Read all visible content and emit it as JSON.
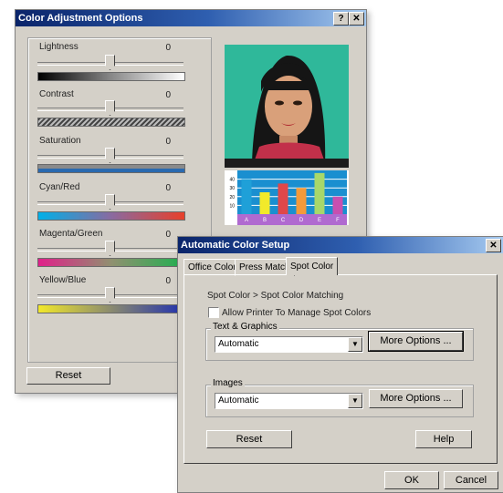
{
  "color_window": {
    "title": "Color Adjustment Options",
    "help_btn": "?",
    "close_btn": "✕",
    "sliders": [
      {
        "label": "Lightness",
        "value": "0"
      },
      {
        "label": "Contrast",
        "value": "0"
      },
      {
        "label": "Saturation",
        "value": "0"
      },
      {
        "label": "Cyan/Red",
        "value": "0"
      },
      {
        "label": "Magenta/Green",
        "value": "0"
      },
      {
        "label": "Yellow/Blue",
        "value": "0"
      }
    ],
    "reset_label": "Reset"
  },
  "preview_chart": {
    "chart_data": {
      "type": "bar",
      "categories": [
        "A",
        "B",
        "C",
        "D",
        "E",
        "F"
      ],
      "series": [
        {
          "values": [
            40,
            25,
            35,
            30,
            47,
            20
          ]
        },
        {
          "values": [
            30,
            null,
            30,
            null,
            40,
            null
          ]
        }
      ],
      "ticks": [
        "10",
        "20",
        "30",
        "40"
      ],
      "ylim": [
        0,
        50
      ],
      "grid": true,
      "colors": [
        "#1fa0d8",
        "#f2ea2a",
        "#e0474a",
        "#f59a3a",
        "#a8d86a",
        "#c84fb0"
      ]
    }
  },
  "spot_window": {
    "title": "Automatic Color Setup",
    "close_btn": "✕",
    "tabs": [
      "Office Color",
      "Press Match",
      "Spot Color"
    ],
    "breadcrumb": "Spot Color > Spot Color Matching",
    "checkbox_label": "Allow Printer To Manage Spot Colors",
    "text_graphics": {
      "label": "Text & Graphics",
      "value": "Automatic",
      "more": "More Options ..."
    },
    "images": {
      "label": "Images",
      "value": "Automatic",
      "more": "More Options ..."
    },
    "reset_label": "Reset",
    "help_label": "Help",
    "ok_label": "OK",
    "cancel_label": "Cancel"
  }
}
